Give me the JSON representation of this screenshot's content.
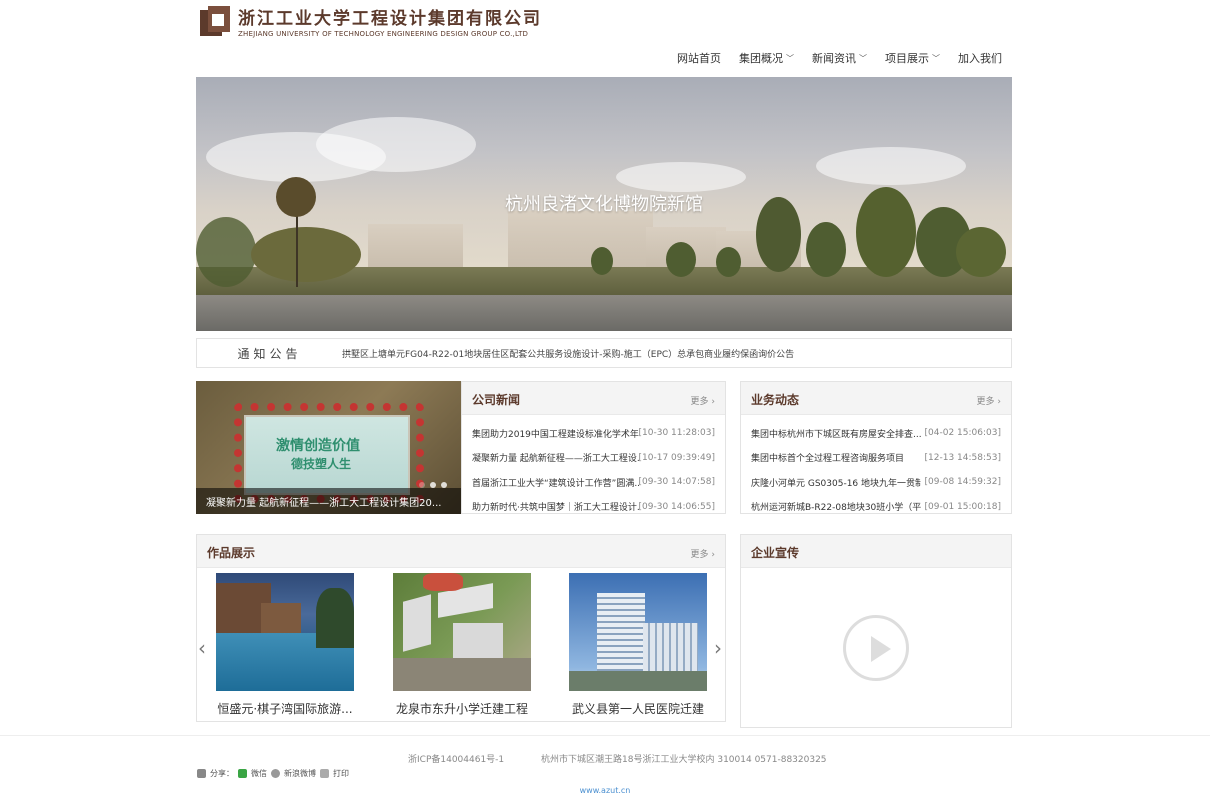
{
  "header": {
    "company_cn": "浙江工业大学工程设计集团有限公司",
    "company_en": "ZHEJIANG UNIVERSITY OF TECHNOLOGY ENGINEERING DESIGN GROUP CO.,LTD"
  },
  "nav": {
    "items": [
      {
        "label": "网站首页"
      },
      {
        "label": "集团概况"
      },
      {
        "label": "新闻资讯"
      },
      {
        "label": "项目展示"
      },
      {
        "label": "加入我们"
      }
    ]
  },
  "banner": {
    "title": "杭州良渚文化博物院新馆"
  },
  "notice": {
    "label": "通知公告",
    "text": "拱墅区上塘单元FG04-R22-01地块居住区配套公共服务设施设计-采购-施工（EPC）总承包商业履约保函询价公告"
  },
  "news_photo": {
    "banner_line1": "激情创造价值",
    "banner_line2": "德技塑人生",
    "caption": "凝聚新力量 起航新征程——浙工大工程设计集团20..."
  },
  "company_news": {
    "title": "公司新闻",
    "more": "更多",
    "rows": [
      {
        "title": "集团助力2019中国工程建设标准化学术年...",
        "date": "[10-30 11:28:03]"
      },
      {
        "title": "凝聚新力量 起航新征程——浙工大工程设...",
        "date": "[10-17 09:39:49]"
      },
      {
        "title": "首届浙江工业大学“建筑设计工作营”圆满...",
        "date": "[09-30 14:07:58]"
      },
      {
        "title": "助力新时代·共筑中国梦｜浙工大工程设计...",
        "date": "[09-30 14:06:55]"
      }
    ]
  },
  "business_news": {
    "title": "业务动态",
    "more": "更多",
    "rows": [
      {
        "title": "集团中标杭州市下城区既有房屋安全排查...",
        "date": "[04-02 15:06:03]"
      },
      {
        "title": "集团中标首个全过程工程咨询服务项目",
        "date": "[12-13 14:58:53]"
      },
      {
        "title": "庆隆小河单元 GS0305-16 地块九年一贯制...",
        "date": "[09-08 14:59:32]"
      },
      {
        "title": "杭州运河新城B-R22-08地块30班小学（平...",
        "date": "[09-01 15:00:18]"
      }
    ]
  },
  "works": {
    "title": "作品展示",
    "more": "更多",
    "items": [
      {
        "caption": "恒盛元·棋子湾国际旅游..."
      },
      {
        "caption": "龙泉市东升小学迁建工程"
      },
      {
        "caption": "武义县第一人民医院迁建"
      }
    ]
  },
  "promo": {
    "title": "企业宣传"
  },
  "footer": {
    "icp": "浙ICP备14004461号-1",
    "address": "杭州市下城区潮王路18号浙江工业大学校内 310014 0571-88320325",
    "share_label": "分享：",
    "share_wechat": "微信",
    "share_weibo": "新浪微博",
    "share_print": "打印",
    "url": "www.azut.cn"
  }
}
